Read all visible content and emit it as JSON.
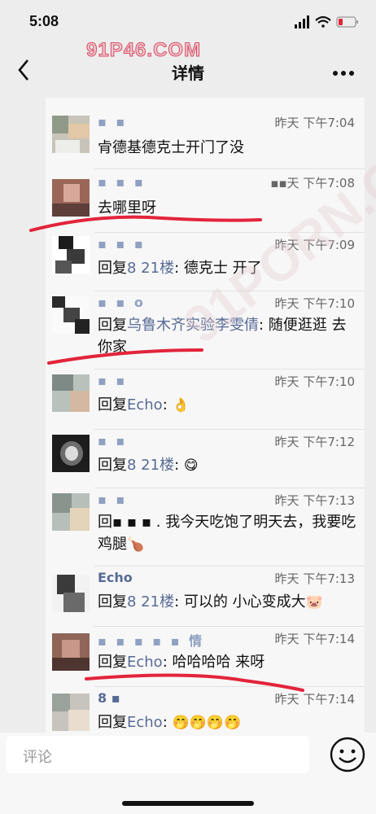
{
  "status_bar": {
    "time": "5:08"
  },
  "watermark": {
    "text": "91P46.COM",
    "background_text": "91PORN.COM"
  },
  "nav": {
    "back_icon": "chevron-left-icon",
    "title": "详情",
    "more_icon": "more-dots-icon"
  },
  "comments": [
    {
      "name": "▪ ▪",
      "time": "昨天 下午7:04",
      "text": "肻德基德克士开门了没",
      "underlined": false
    },
    {
      "name": "▪ ▪ ▪",
      "time": "▪▪天 下午7:08",
      "text": "去哪里呀",
      "underlined": true
    },
    {
      "name": "▪ ▪ ▪",
      "time": "昨天 下午7:09",
      "reply_prefix": "回复",
      "reply_to": "8 21楼",
      "text": ": 德克士 开了"
    },
    {
      "name": "▪ ▪ o",
      "time": "昨天 下午7:10",
      "reply_prefix": "回复",
      "reply_to": "乌鲁木齐实验李雯倩",
      "text": ": 随便逛逛 去你家",
      "underlined": true
    },
    {
      "name": "▪ ▪",
      "time": "昨天 下午7:10",
      "reply_prefix": "回复",
      "reply_to": "Echo",
      "text": ": ",
      "emoji": "👌"
    },
    {
      "name": "▪ ▪",
      "time": "昨天 下午7:12",
      "reply_prefix": "回复",
      "reply_to": "8 21楼",
      "text": ": ",
      "emoji": "😋"
    },
    {
      "name": "▪ ▪",
      "time": "昨天 下午7:13",
      "text": "回▪ ▪ ▪ . 我今天吃饱了明天去，我要吃鸡腿",
      "emoji": "🍗"
    },
    {
      "name": "Echo",
      "time": "昨天 下午7:13",
      "reply_prefix": "回复",
      "reply_to": "8 21楼",
      "text": ": 可以的 小心变成大",
      "emoji": "🐷"
    },
    {
      "name": "▪ ▪ ▪ ▪ ▪ 情",
      "time": "昨天 下午7:14",
      "reply_prefix": "回复",
      "reply_to": "Echo",
      "text": ": 哈哈哈哈 来呀",
      "underlined": true
    },
    {
      "name": "8 ▪",
      "time": "昨天 下午7:14",
      "reply_prefix": "回复",
      "reply_to": "Echo",
      "text": ": ",
      "emoji": "🤭🤭🤭🤭"
    }
  ],
  "input": {
    "placeholder": "评论",
    "emoji_icon": "smiley-face-icon"
  },
  "colors": {
    "link": "#576b95",
    "underline": "#e3243b",
    "background": "#ededed"
  }
}
